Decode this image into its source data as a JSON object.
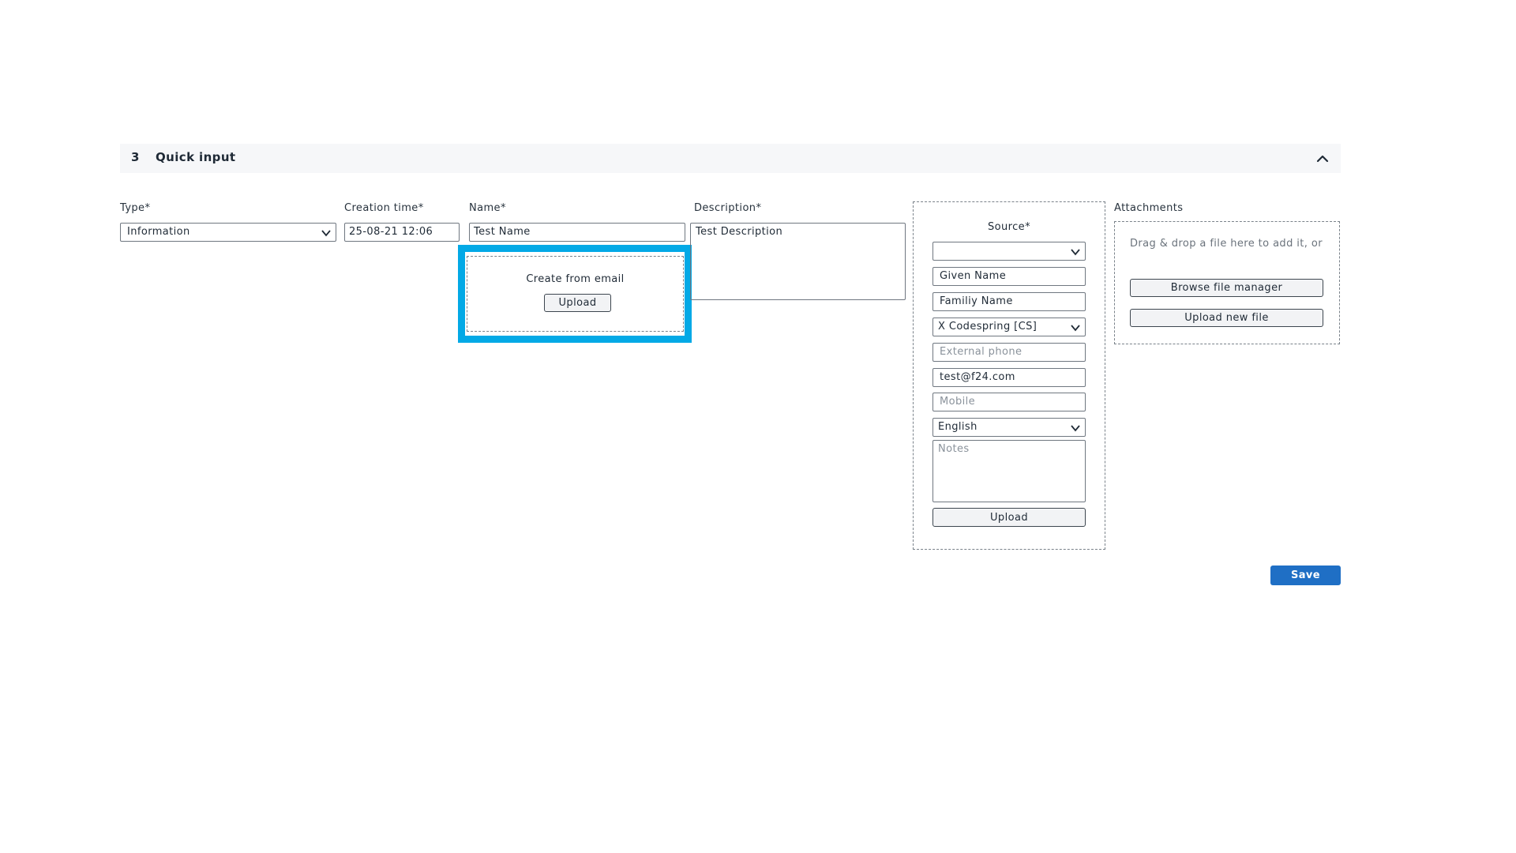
{
  "section": {
    "number": "3",
    "title": "Quick input",
    "collapse_icon": "chevron-up-icon"
  },
  "type": {
    "label": "Type*",
    "value": "Information"
  },
  "creation_time": {
    "label": "Creation time*",
    "value": "25-08-21 12:06"
  },
  "name": {
    "label": "Name*",
    "value": "Test Name"
  },
  "description": {
    "label": "Description*",
    "value": "Test Description"
  },
  "create_from_email": {
    "label": "Create from email",
    "upload_label": "Upload"
  },
  "source": {
    "label": "Source*",
    "select_value": "",
    "given_name": "Given Name",
    "family_name": "Familiy Name",
    "company": "X Codespring [CS]",
    "external_phone_placeholder": "External phone",
    "email": "test@f24.com",
    "mobile_placeholder": "Mobile",
    "language": "English",
    "notes_placeholder": "Notes",
    "upload_label": "Upload"
  },
  "attachments": {
    "label": "Attachments",
    "hint": "Drag & drop a file here to add it, or",
    "browse_label": "Browse file manager",
    "upload_new_label": "Upload new file"
  },
  "save_label": "Save",
  "colors": {
    "highlight": "#03a9e6",
    "primary": "#1f6fc5"
  }
}
